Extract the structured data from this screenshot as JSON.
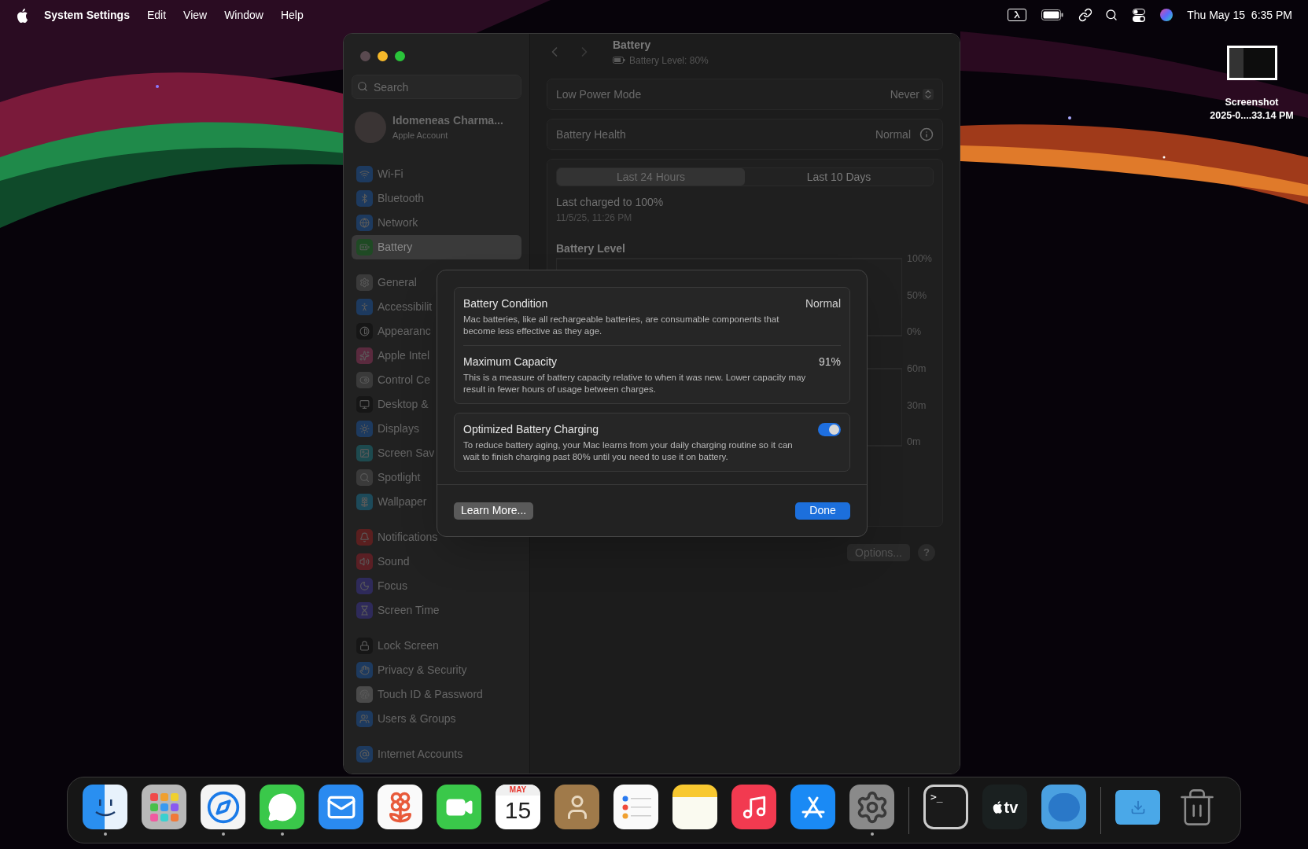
{
  "menu_bar": {
    "menus": [
      {
        "label": "System Settings"
      },
      {
        "label": "Edit"
      },
      {
        "label": "View"
      },
      {
        "label": "Window"
      },
      {
        "label": "Help"
      }
    ],
    "clock": "Thu May 15  6:35 PM"
  },
  "desktop_file": {
    "lines": [
      "Screenshot",
      "2025-0....33.14 PM"
    ]
  },
  "window": {
    "sidebar": {
      "search": {
        "placeholder": "Search"
      },
      "account": {
        "name": "Idomeneas Charma...",
        "subtitle": "Apple Account"
      },
      "groups": [
        [
          {
            "label": "Wi-Fi",
            "color": "#1d3a5f",
            "selected": false
          },
          {
            "label": "Bluetooth",
            "color": "#1d3a5f",
            "selected": false
          },
          {
            "label": "Network",
            "color": "#1d3a5f",
            "selected": false
          },
          {
            "label": "Battery",
            "color": "#1f4a24",
            "selected": true
          }
        ],
        [
          {
            "label": "General",
            "color": "#3a3a3a",
            "selected": false
          },
          {
            "label": "Accessibilit",
            "color": "#1d3a5f",
            "selected": false
          },
          {
            "label": "Appearanc",
            "color": "#161616",
            "selected": false
          },
          {
            "label": "Apple Intel",
            "color": "#5a2a3e",
            "selected": false
          },
          {
            "label": "Control Ce",
            "color": "#3a3a3a",
            "selected": false
          },
          {
            "label": "Desktop &",
            "color": "#161616",
            "selected": false
          },
          {
            "label": "Displays",
            "color": "#1d3a5f",
            "selected": false
          },
          {
            "label": "Screen Sav",
            "color": "#1d4a4f",
            "selected": false
          },
          {
            "label": "Spotlight",
            "color": "#3a3a3a",
            "selected": false
          },
          {
            "label": "Wallpaper",
            "color": "#1d4a5a",
            "selected": false
          }
        ],
        [
          {
            "label": "Notifications",
            "color": "#5a1f1f",
            "selected": false
          },
          {
            "label": "Sound",
            "color": "#5a1f24",
            "selected": false
          },
          {
            "label": "Focus",
            "color": "#2e2a5a",
            "selected": false
          },
          {
            "label": "Screen Time",
            "color": "#2e2a5a",
            "selected": false
          }
        ],
        [
          {
            "label": "Lock Screen",
            "color": "#161616",
            "selected": false
          },
          {
            "label": "Privacy & Security",
            "color": "#1d3a5f",
            "selected": false
          },
          {
            "label": "Touch ID & Password",
            "color": "#4a4a4a",
            "selected": false
          },
          {
            "label": "Users & Groups",
            "color": "#1d3a5f",
            "selected": false
          }
        ],
        [
          {
            "label": "Internet Accounts",
            "color": "#1d3a5f",
            "selected": false
          }
        ]
      ]
    },
    "header": {
      "title": "Battery",
      "subtitle": "Battery Level: 80%"
    },
    "rows": [
      {
        "label": "Low Power Mode",
        "value": "Never",
        "kind": "popup"
      },
      {
        "label": "Battery Health",
        "value": "Normal",
        "kind": "info"
      }
    ],
    "usage": {
      "tabs": [
        {
          "label": "Last 24 Hours",
          "selected": true
        },
        {
          "label": "Last 10 Days",
          "selected": false
        }
      ],
      "last_charged": "Last charged to 100%",
      "charged_date": "11/5/25, 11:26 PM",
      "level_title": "Battery Level",
      "level_ticks": [
        "100%",
        "50%",
        "0%"
      ],
      "usage_ticks": [
        "60m",
        "30m",
        "0m"
      ]
    },
    "footer_buttons": {
      "options": "Options...",
      "help": "?"
    }
  },
  "dialog": {
    "sections": [
      [
        {
          "title": "Battery Condition",
          "value": "Normal",
          "text": "Mac batteries, like all rechargeable batteries, are consumable components that become less effective as they age.",
          "kind": "value"
        },
        {
          "title": "Maximum Capacity",
          "value": "91%",
          "text": "This is a measure of battery capacity relative to when it was new. Lower capacity may result in fewer hours of usage between charges.",
          "kind": "value"
        }
      ],
      [
        {
          "title": "Optimized Battery Charging",
          "on": true,
          "text": "To reduce battery aging, your Mac learns from your daily charging routine so it can wait to finish charging past 80% until you need to use it on battery.",
          "kind": "toggle"
        }
      ]
    ],
    "learn_more": "Learn More...",
    "done": "Done"
  },
  "dock": {
    "groups": [
      [
        {
          "running": true
        },
        {
          "running": false
        },
        {
          "running": true
        },
        {
          "running": true
        },
        {
          "running": false
        },
        {
          "running": false
        },
        {
          "running": false
        },
        {
          "running": false,
          "texts": [
            "MAY",
            "15"
          ]
        },
        {
          "running": false
        },
        {
          "running": false
        },
        {
          "running": false
        },
        {
          "running": false
        },
        {
          "running": false
        },
        {
          "running": true
        }
      ],
      [
        {
          "running": false,
          "texts": [
            ">_"
          ]
        },
        {
          "running": false,
          "texts": [
            "tv"
          ]
        },
        {
          "running": false
        }
      ],
      [
        {
          "running": false
        },
        {
          "running": false
        }
      ]
    ]
  }
}
